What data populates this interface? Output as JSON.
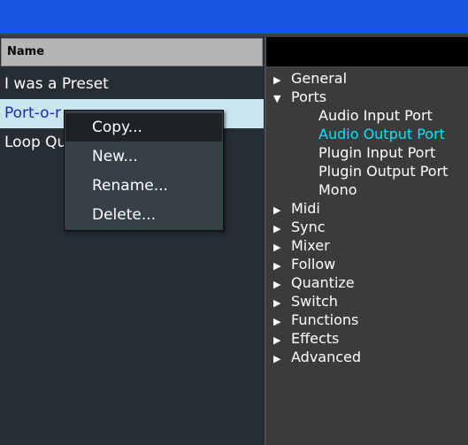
{
  "list": {
    "column_header": "Name",
    "rows": [
      "I was a Preset",
      "Port-o-r",
      "Loop Qu"
    ]
  },
  "context_menu": {
    "items": [
      "Copy...",
      "New...",
      "Rename...",
      "Delete..."
    ]
  },
  "tree": {
    "general": "General",
    "ports": "Ports",
    "ports_children": [
      "Audio Input Port",
      "Audio Output Port",
      "Plugin Input Port",
      "Plugin Output Port",
      "Mono"
    ],
    "midi": "Midi",
    "sync": "Sync",
    "mixer": "Mixer",
    "follow": "Follow",
    "quantize": "Quantize",
    "switch": "Switch",
    "functions": "Functions",
    "effects": "Effects",
    "advanced": "Advanced",
    "arrow_collapsed": "▶",
    "arrow_expanded": "▼"
  },
  "colors": {
    "title_bar": "#1856e2",
    "selected_row_bg": "#c9e6ee",
    "selected_tree_item": "#00e5ff"
  }
}
